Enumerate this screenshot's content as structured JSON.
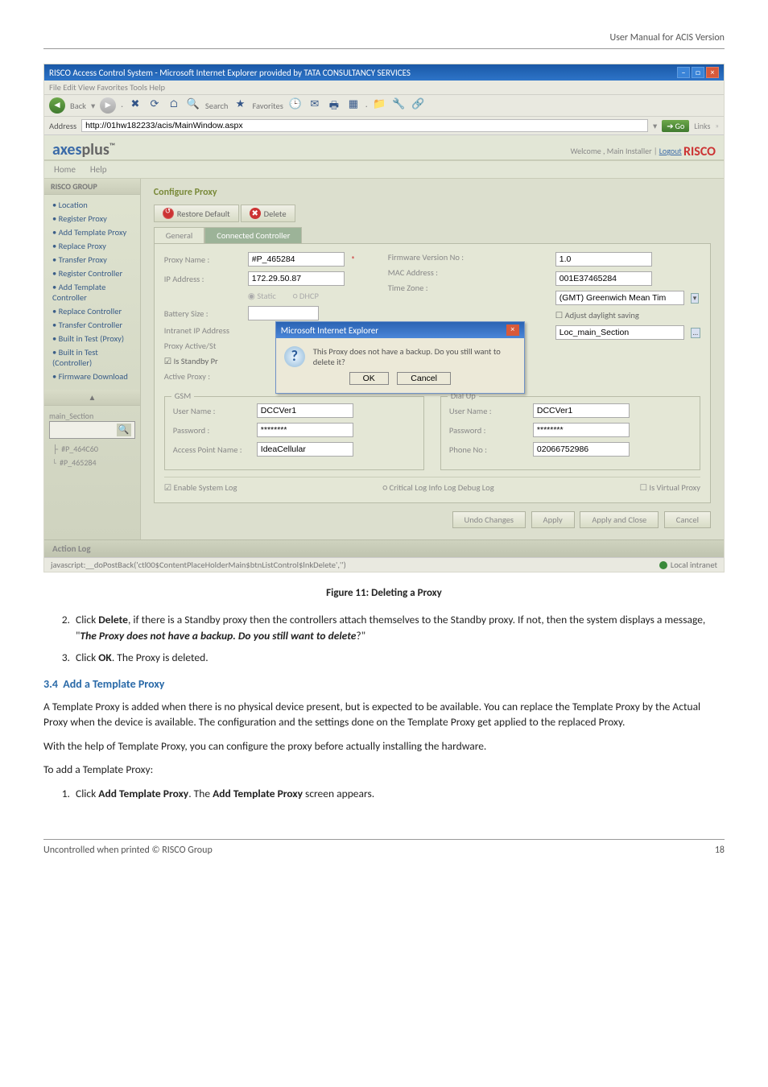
{
  "header": {
    "right": "User Manual for ACIS Version"
  },
  "screenshot": {
    "titlebar": "RISCO Access Control System - Microsoft Internet Explorer provided by TATA CONSULTANCY SERVICES",
    "menu": "File   Edit   View   Favorites   Tools   Help",
    "toolbar": {
      "back": "Back",
      "search": "Search",
      "favorites": "Favorites"
    },
    "addr": {
      "label": "Address",
      "url": "http://01hw182233/acis/MainWindow.aspx",
      "go": "Go",
      "links": "Links"
    },
    "brand": {
      "logo_a": "axes",
      "logo_b": "plus",
      "welcome": "Welcome , Main Installer | ",
      "logout": "Logout",
      "risco": "RISCO"
    },
    "tabs": {
      "home": "Home",
      "help": "Help"
    },
    "side": {
      "panel1": "RISCO GROUP",
      "items": [
        "Location",
        "Register Proxy",
        "Add Template Proxy",
        "Replace Proxy",
        "Transfer Proxy",
        "Register Controller",
        "Add Template Controller",
        "Replace Controller",
        "Transfer Controller",
        "Built in Test (Proxy)",
        "Built in Test (Controller)",
        "Firmware Download"
      ],
      "panel2": "main_Section",
      "tree": {
        "n1": "#P_464C60",
        "n2": "#P_465284"
      }
    },
    "main": {
      "title": "Configure Proxy",
      "btn_restore": "Restore Default",
      "btn_delete": "Delete",
      "tab_general": "General",
      "tab_conn": "Connected Controller",
      "proxy_name_lbl": "Proxy Name :",
      "proxy_name": "#P_465284",
      "ip_lbl": "IP Address :",
      "ip": "172.29.50.87",
      "static_lbl": "Static",
      "dhcp_lbl": "DHCP",
      "battery_lbl": "Battery Size :",
      "intranet_lbl": "Intranet IP Address",
      "proxy_active_lbl": "Proxy Active/St",
      "is_standby_lbl": "Is Standby Pr",
      "active_proxy_lbl": "Active Proxy :",
      "fw_lbl": "Firmware Version No :",
      "fw": "1.0",
      "mac_lbl": "MAC Address :",
      "mac": "001E37465284",
      "tz_lbl": "Time Zone :",
      "tz": "(GMT) Greenwich Mean Tim",
      "adj_lbl": "Adjust daylight saving",
      "loc_lbl": "",
      "loc": "Loc_main_Section",
      "dialog": {
        "title": "Microsoft Internet Explorer",
        "msg": "This Proxy does not have a backup. Do you still want to delete it?",
        "ok": "OK",
        "cancel": "Cancel"
      },
      "gsm": {
        "legend": "GSM",
        "user_lbl": "User Name :",
        "user": "DCCVer1",
        "pwd_lbl": "Password :",
        "pwd": "********",
        "apn_lbl": "Access Point Name :",
        "apn": "IdeaCellular"
      },
      "dialup": {
        "legend": "Dial Up",
        "user_lbl": "User Name :",
        "user": "DCCVer1",
        "pwd_lbl": "Password :",
        "pwd": "********",
        "phone_lbl": "Phone No :",
        "phone": "02066752986"
      },
      "enable_lbl": "Enable System Log",
      "logopts": "Critical Log   Info Log   Debug Log",
      "virtual": "Is Virtual Proxy",
      "undo": "Undo Changes",
      "apply": "Apply",
      "applyclose": "Apply and Close",
      "cancel": "Cancel"
    },
    "actionlog": "Action Log",
    "status": {
      "left": "javascript:__doPostBack('ctl00$ContentPlaceHolderMain$btnListControl$lnkDelete','')",
      "right": "Local intranet"
    }
  },
  "caption": "Figure 11: Deleting a Proxy",
  "steps1": {
    "s2a": "Click ",
    "s2b": "Delete",
    "s2c": ", if there is a Standby proxy then the controllers attach themselves to the Standby proxy. If not, then the system displays a message, \"",
    "s2d": "The Proxy does not have a backup. Do you still want to delete",
    "s2e": "?\"",
    "s3a": "Click ",
    "s3b": "OK",
    "s3c": ". The Proxy is deleted."
  },
  "section": {
    "num": "3.4",
    "title": "Add a Template Proxy"
  },
  "para1": "A Template Proxy is added when there is no physical device present, but is expected to be available. You can replace the Template Proxy by the Actual Proxy when the device is available. The configuration and the settings done on the Template Proxy get applied to the replaced Proxy.",
  "para2": "With the help of Template Proxy, you can configure the proxy before actually installing the hardware.",
  "para3": "To add a Template Proxy:",
  "steps2": {
    "s1a": "Click ",
    "s1b": "Add Template Proxy",
    "s1c": ". The ",
    "s1d": "Add Template Proxy",
    "s1e": " screen appears."
  },
  "footer": {
    "left": "Uncontrolled when printed © RISCO Group",
    "right": "18"
  }
}
